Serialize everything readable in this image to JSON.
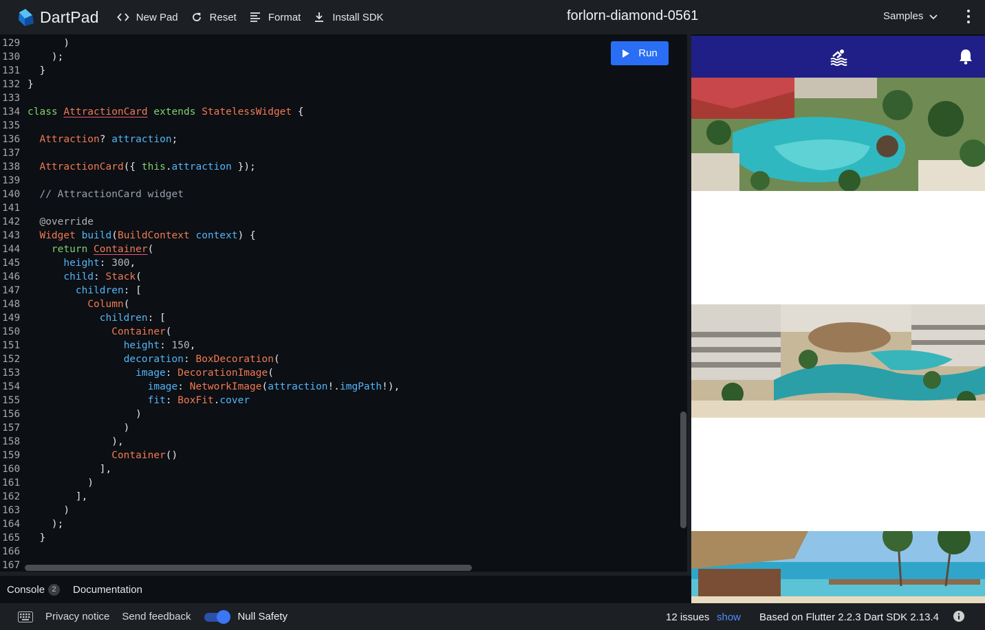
{
  "app": {
    "name": "DartPad",
    "pad_title": "forlorn-diamond-0561"
  },
  "toolbar": {
    "new_pad": "New Pad",
    "reset": "Reset",
    "format": "Format",
    "install_sdk": "Install SDK",
    "samples": "Samples"
  },
  "editor": {
    "run_label": "Run",
    "lines": [
      {
        "n": "129",
        "t": [
          [
            "      )",
            "p"
          ]
        ]
      },
      {
        "n": "130",
        "t": [
          [
            "    );",
            "p"
          ]
        ]
      },
      {
        "n": "131",
        "t": [
          [
            "  }",
            "p"
          ]
        ]
      },
      {
        "n": "132",
        "t": [
          [
            "}",
            "p"
          ]
        ]
      },
      {
        "n": "133",
        "t": []
      },
      {
        "n": "134",
        "t": [
          [
            "class",
            "kw"
          ],
          [
            " ",
            "p"
          ],
          [
            "AttractionCard",
            "type-err"
          ],
          [
            " ",
            "p"
          ],
          [
            "extends",
            "kw"
          ],
          [
            " ",
            "p"
          ],
          [
            "StatelessWidget",
            "type"
          ],
          [
            " {",
            "p"
          ]
        ]
      },
      {
        "n": "135",
        "t": []
      },
      {
        "n": "136",
        "t": [
          [
            "  ",
            "p"
          ],
          [
            "Attraction",
            "type"
          ],
          [
            "? ",
            "p"
          ],
          [
            "attraction",
            "id"
          ],
          [
            ";",
            "p"
          ]
        ]
      },
      {
        "n": "137",
        "t": []
      },
      {
        "n": "138",
        "t": [
          [
            "  ",
            "p"
          ],
          [
            "AttractionCard",
            "type"
          ],
          [
            "({ ",
            "p"
          ],
          [
            "this",
            "kw"
          ],
          [
            ".",
            "p"
          ],
          [
            "attraction",
            "id"
          ],
          [
            " });",
            "p"
          ]
        ]
      },
      {
        "n": "139",
        "t": []
      },
      {
        "n": "140",
        "t": [
          [
            "  // AttractionCard widget",
            "cm"
          ]
        ]
      },
      {
        "n": "141",
        "t": []
      },
      {
        "n": "142",
        "t": [
          [
            "  @override",
            "an"
          ]
        ]
      },
      {
        "n": "143",
        "t": [
          [
            "  ",
            "p"
          ],
          [
            "Widget",
            "type"
          ],
          [
            " ",
            "p"
          ],
          [
            "build",
            "id"
          ],
          [
            "(",
            "p"
          ],
          [
            "BuildContext",
            "type"
          ],
          [
            " ",
            "p"
          ],
          [
            "context",
            "id"
          ],
          [
            ") {",
            "p"
          ]
        ]
      },
      {
        "n": "144",
        "t": [
          [
            "    ",
            "p"
          ],
          [
            "return",
            "kw"
          ],
          [
            " ",
            "p"
          ],
          [
            "Container",
            "type-err"
          ],
          [
            "(",
            "p"
          ]
        ]
      },
      {
        "n": "145",
        "t": [
          [
            "      ",
            "p"
          ],
          [
            "height",
            "id"
          ],
          [
            ": ",
            "p"
          ],
          [
            "300",
            "num"
          ],
          [
            ",",
            "p"
          ]
        ]
      },
      {
        "n": "146",
        "t": [
          [
            "      ",
            "p"
          ],
          [
            "child",
            "id"
          ],
          [
            ": ",
            "p"
          ],
          [
            "Stack",
            "type"
          ],
          [
            "(",
            "p"
          ]
        ]
      },
      {
        "n": "147",
        "t": [
          [
            "        ",
            "p"
          ],
          [
            "children",
            "id"
          ],
          [
            ": [",
            "p"
          ]
        ]
      },
      {
        "n": "148",
        "t": [
          [
            "          ",
            "p"
          ],
          [
            "Column",
            "type"
          ],
          [
            "(",
            "p"
          ]
        ]
      },
      {
        "n": "149",
        "t": [
          [
            "            ",
            "p"
          ],
          [
            "children",
            "id"
          ],
          [
            ": [",
            "p"
          ]
        ]
      },
      {
        "n": "150",
        "t": [
          [
            "              ",
            "p"
          ],
          [
            "Container",
            "type"
          ],
          [
            "(",
            "p"
          ]
        ]
      },
      {
        "n": "151",
        "t": [
          [
            "                ",
            "p"
          ],
          [
            "height",
            "id"
          ],
          [
            ": ",
            "p"
          ],
          [
            "150",
            "num"
          ],
          [
            ",",
            "p"
          ]
        ]
      },
      {
        "n": "152",
        "t": [
          [
            "                ",
            "p"
          ],
          [
            "decoration",
            "id"
          ],
          [
            ": ",
            "p"
          ],
          [
            "BoxDecoration",
            "type"
          ],
          [
            "(",
            "p"
          ]
        ]
      },
      {
        "n": "153",
        "t": [
          [
            "                  ",
            "p"
          ],
          [
            "image",
            "id"
          ],
          [
            ": ",
            "p"
          ],
          [
            "DecorationImage",
            "type"
          ],
          [
            "(",
            "p"
          ]
        ]
      },
      {
        "n": "154",
        "t": [
          [
            "                    ",
            "p"
          ],
          [
            "image",
            "id"
          ],
          [
            ": ",
            "p"
          ],
          [
            "NetworkImage",
            "type"
          ],
          [
            "(",
            "p"
          ],
          [
            "attraction",
            "id"
          ],
          [
            "!.",
            "p"
          ],
          [
            "imgPath",
            "id"
          ],
          [
            "!),",
            "p"
          ]
        ]
      },
      {
        "n": "155",
        "t": [
          [
            "                    ",
            "p"
          ],
          [
            "fit",
            "id"
          ],
          [
            ": ",
            "p"
          ],
          [
            "BoxFit",
            "type"
          ],
          [
            ".",
            "p"
          ],
          [
            "cover",
            "id"
          ]
        ]
      },
      {
        "n": "156",
        "t": [
          [
            "                  )",
            "p"
          ]
        ]
      },
      {
        "n": "157",
        "t": [
          [
            "                )",
            "p"
          ]
        ]
      },
      {
        "n": "158",
        "t": [
          [
            "              ),",
            "p"
          ]
        ]
      },
      {
        "n": "159",
        "t": [
          [
            "              ",
            "p"
          ],
          [
            "Container",
            "type"
          ],
          [
            "()",
            "p"
          ]
        ]
      },
      {
        "n": "160",
        "t": [
          [
            "            ],",
            "p"
          ]
        ]
      },
      {
        "n": "161",
        "t": [
          [
            "          )",
            "p"
          ]
        ]
      },
      {
        "n": "162",
        "t": [
          [
            "        ],",
            "p"
          ]
        ]
      },
      {
        "n": "163",
        "t": [
          [
            "      )",
            "p"
          ]
        ]
      },
      {
        "n": "164",
        "t": [
          [
            "    );",
            "p"
          ]
        ]
      },
      {
        "n": "165",
        "t": [
          [
            "  }",
            "p"
          ]
        ]
      },
      {
        "n": "166",
        "t": []
      },
      {
        "n": "167",
        "t": []
      }
    ]
  },
  "console": {
    "console_label": "Console",
    "console_count": "2",
    "documentation_label": "Documentation"
  },
  "status": {
    "privacy": "Privacy notice",
    "feedback": "Send feedback",
    "null_safety": "Null Safety",
    "null_safety_on": true,
    "issues": "12 issues",
    "show": "show",
    "sdk": "Based on Flutter 2.2.3 Dart SDK 2.13.4"
  },
  "preview": {
    "appbar_color": "#1f1f87",
    "icons": [
      "pool-icon",
      "notifications-icon"
    ]
  },
  "colors": {
    "accent": "#2a6ef5",
    "background": "#0c0f14",
    "toolbar": "#1c1f24"
  }
}
